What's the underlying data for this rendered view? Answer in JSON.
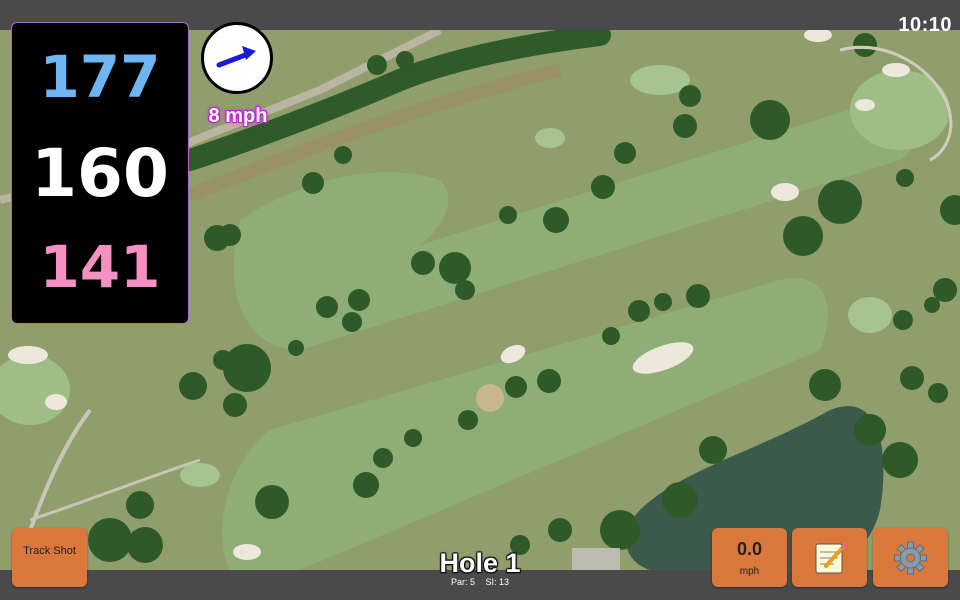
{
  "status_bar": {
    "time": "10:10"
  },
  "distances": {
    "back": "177",
    "center": "160",
    "front": "141"
  },
  "wind": {
    "speed": "8 mph",
    "direction_icon": "arrow-right-icon"
  },
  "hole": {
    "title": "Hole 1",
    "par": "Par: 5",
    "stroke_index": "SI: 13"
  },
  "buttons": {
    "track_shot": "Track Shot",
    "speed_value": "0.0",
    "speed_unit": "mph",
    "notes_icon": "notepad-icon",
    "settings_icon": "gear-icon"
  },
  "colors": {
    "button": "#d9783a",
    "back_distance": "#6fb5f2",
    "front_distance": "#f590c2",
    "panel_border": "#b06cc4",
    "wind_label_glow": "#c31fd6"
  }
}
